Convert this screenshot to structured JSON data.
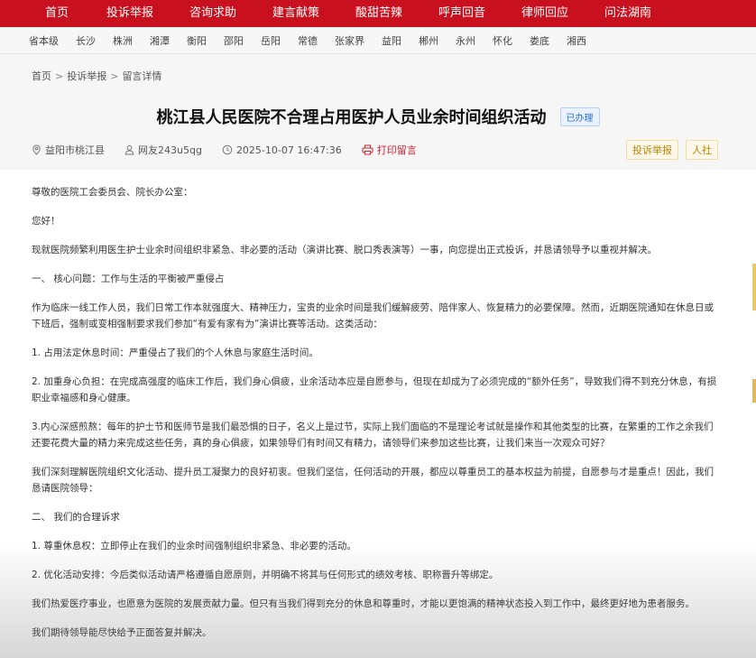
{
  "top_nav": [
    "首页",
    "投诉举报",
    "咨询求助",
    "建言献策",
    "酸甜苦辣",
    "呼声回音",
    "律师回应",
    "问法湖南"
  ],
  "cities": [
    "省本级",
    "长沙",
    "株洲",
    "湘潭",
    "衡阳",
    "邵阳",
    "岳阳",
    "常德",
    "张家界",
    "益阳",
    "郴州",
    "永州",
    "怀化",
    "娄底",
    "湘西"
  ],
  "breadcrumb": {
    "home": "首页",
    "section": "投诉举报",
    "current": "留言详情",
    "separator": ">"
  },
  "article": {
    "title": "桃江县人民医院不合理占用医护人员业余时间组织活动",
    "status": "已办理",
    "location": "益阳市桃江县",
    "author": "网友243u5qg",
    "datetime": "2025-10-07 16:47:36",
    "print_label": "打印留言",
    "tags": [
      "投诉举报",
      "人社"
    ]
  },
  "paragraphs": [
    "尊敬的医院工会委员会、院长办公室：",
    "您好！",
    "现就医院频繁利用医生护士业余时间组织非紧急、非必要的活动（演讲比赛、脱口秀表演等）一事，向您提出正式投诉，并恳请领导予以重视并解决。",
    "一、 核心问题：工作与生活的平衡被严重侵占",
    "作为临床一线工作人员，我们日常工作本就强度大、精神压力，宝贵的业余时间是我们缓解疲劳、陪伴家人、恢复精力的必要保障。然而，近期医院通知在休息日或下班后，强制或变相强制要求我们参加“有爱有家有为”演讲比赛等活动。这类活动：",
    "1. 占用法定休息时间：严重侵占了我们的个人休息与家庭生活时间。",
    "2. 加重身心负担：在完成高强度的临床工作后，我们身心俱疲，业余活动本应是自愿参与，但现在却成为了必须完成的“额外任务”，导致我们得不到充分休息，有损职业幸福感和身心健康。",
    "3.内心深感煎熬：每年的护士节和医师节是我们最恐惧的日子，名义上是过节，实际上我们面临的不是理论考试就是操作和其他类型的比赛，在繁重的工作之余我们还要花费大量的精力来完成这些任务，真的身心俱疲，如果领导们有时间又有精力，请领导们来参加这些比赛，让我们来当一次观众可好？",
    "我们深刻理解医院组织文化活动、提升员工凝聚力的良好初衷。但我们坚信，任何活动的开展，都应以尊重员工的基本权益为前提，自愿参与才是重点！因此，我们恳请医院领导：",
    "二、 我们的合理诉求",
    "1. 尊重休息权：立即停止在我们的业余时间强制组织非紧急、非必要的活动。",
    "2. 优化活动安排：今后类似活动请严格遵循自愿原则，并明确不将其与任何形式的绩效考核、职称晋升等绑定。",
    "我们热爱医疗事业，也愿意为医院的发展贡献力量。但只有当我们得到充分的休息和尊重时，才能以更饱满的精神状态投入到工作中，最终更好地为患者服务。",
    "我们期待领导能尽快给予正面答复并解决。"
  ]
}
